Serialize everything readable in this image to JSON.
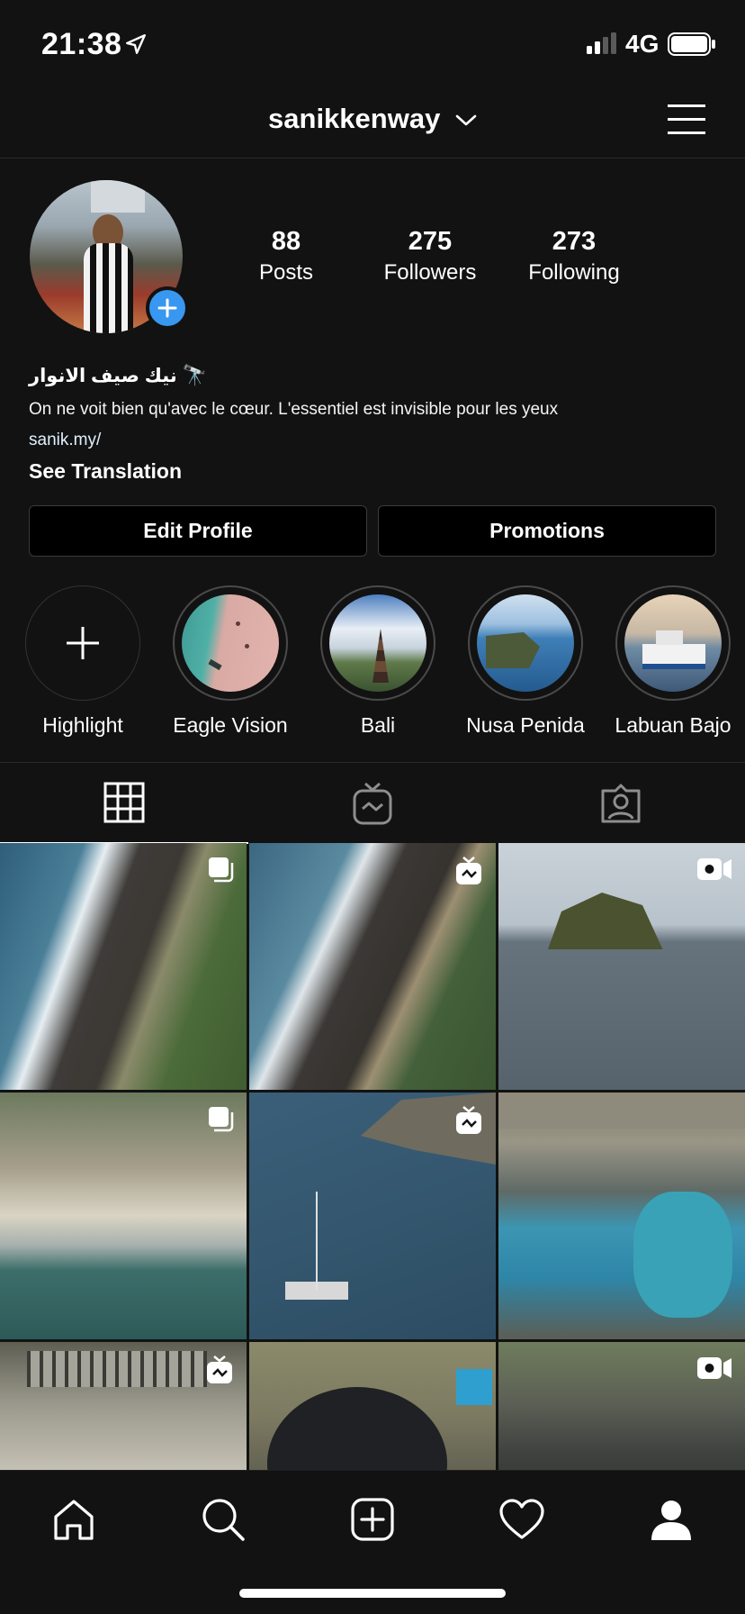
{
  "status_bar": {
    "time": "21:38",
    "network": "4G"
  },
  "header": {
    "username": "sanikkenway"
  },
  "profile": {
    "stats": [
      {
        "value": "88",
        "label": "Posts"
      },
      {
        "value": "275",
        "label": "Followers"
      },
      {
        "value": "273",
        "label": "Following"
      }
    ],
    "bio_name": "نيك صيف الانوار",
    "bio_text": "On ne voit bien qu'avec le cœur. L'essentiel est invisible pour les yeux",
    "bio_link": "sanik.my/",
    "see_translation": "See Translation"
  },
  "buttons": {
    "edit_profile": "Edit Profile",
    "promotions": "Promotions"
  },
  "highlights": [
    {
      "label": "Highlight"
    },
    {
      "label": "Eagle Vision"
    },
    {
      "label": "Bali"
    },
    {
      "label": "Nusa Penida"
    },
    {
      "label": "Labuan Bajo"
    }
  ],
  "tabs": [
    "grid-tab",
    "igtv-tab",
    "tagged-tab"
  ],
  "posts": [
    {
      "badge": "carousel-icon"
    },
    {
      "badge": "igtv-icon"
    },
    {
      "badge": "video-icon"
    },
    {
      "badge": "carousel-icon"
    },
    {
      "badge": "igtv-icon"
    },
    {
      "badge": "none"
    },
    {
      "badge": "igtv-icon"
    },
    {
      "badge": "none"
    },
    {
      "badge": "video-icon"
    }
  ],
  "colors": {
    "background": "#121212",
    "accent": "#3897f0"
  }
}
